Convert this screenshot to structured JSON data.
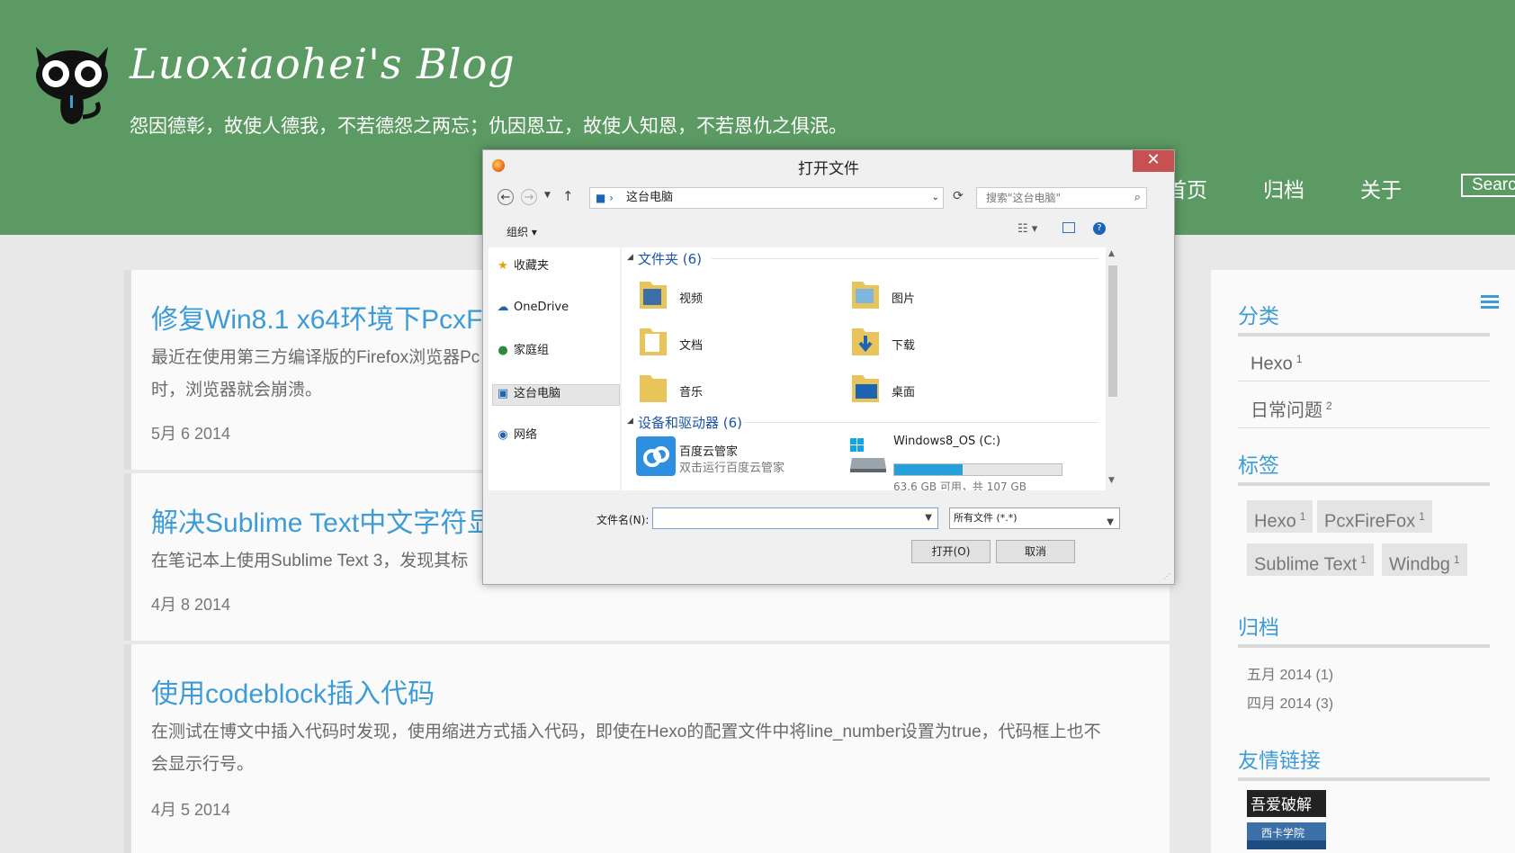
{
  "header": {
    "site_title": "Luoxiaohei's Blog",
    "subtitle": "怨因德彰，故使人德我，不若德怨之两忘；仇因恩立，故使人知恩，不若恩仇之俱泯。",
    "nav": [
      "首页",
      "归档",
      "关于"
    ],
    "search_placeholder": "Search"
  },
  "posts": [
    {
      "title": "修复Win8.1 x64环境下PcxFi",
      "body": "最近在使用第三方编译版的Firefox浏览器Pc 时，浏览器就会崩溃。",
      "line1": "最近在使用第三方编译版的Firefox浏览器Pc",
      "line2": "时，浏览器就会崩溃。",
      "date": "5月 6 2014"
    },
    {
      "title": "解决Sublime Text中文字符显",
      "line1": "在笔记本上使用Sublime Text 3，发现其标",
      "date": "4月 8 2014"
    },
    {
      "title": "使用codeblock插入代码",
      "line1": "在测试在博文中插入代码时发现，使用缩进方式插入代码，即使在Hexo的配置文件中将line_number设置为true，代码框上也不",
      "line2": "会显示行号。",
      "date": "4月 5 2014"
    }
  ],
  "sidebar": {
    "categories_title": "分类",
    "categories": [
      {
        "name": "Hexo",
        "count": "1"
      },
      {
        "name": "日常问题",
        "count": "2"
      }
    ],
    "tags_title": "标签",
    "tags": [
      {
        "name": "Hexo",
        "count": "1"
      },
      {
        "name": "PcxFireFox",
        "count": "1"
      },
      {
        "name": "Sublime Text",
        "count": "1"
      },
      {
        "name": "Windbg",
        "count": "1"
      }
    ],
    "archives_title": "归档",
    "archives": [
      "五月 2014 (1)",
      "四月 2014 (3)"
    ],
    "links_title": "友情链接",
    "links": [
      "吾爱破解",
      "西卡学院"
    ]
  },
  "dialog": {
    "title": "打开文件",
    "close": "✕",
    "address": "这台电脑",
    "search_placeholder": "搜索\"这台电脑\"",
    "organize": "组织 ▾",
    "tree": [
      "收藏夹",
      "OneDrive",
      "家庭组",
      "这台电脑",
      "网络"
    ],
    "folders_header": "文件夹 (6)",
    "folders": [
      "视频",
      "图片",
      "文档",
      "下载",
      "音乐",
      "桌面"
    ],
    "devices_header": "设备和驱动器 (6)",
    "app_name": "百度云管家",
    "app_desc": "双击运行百度云管家",
    "drive_name": "Windows8_OS (C:)",
    "drive_space": "63.6 GB 可用，共 107 GB",
    "drive_used_fraction": 0.41,
    "filename_label": "文件名(N):",
    "filetype": "所有文件 (*.*)",
    "open_button": "打开(O)",
    "cancel_button": "取消"
  },
  "colors": {
    "header_bg": "#5c9a63",
    "link_blue": "#3d9bd5",
    "close_red": "#c75050"
  }
}
